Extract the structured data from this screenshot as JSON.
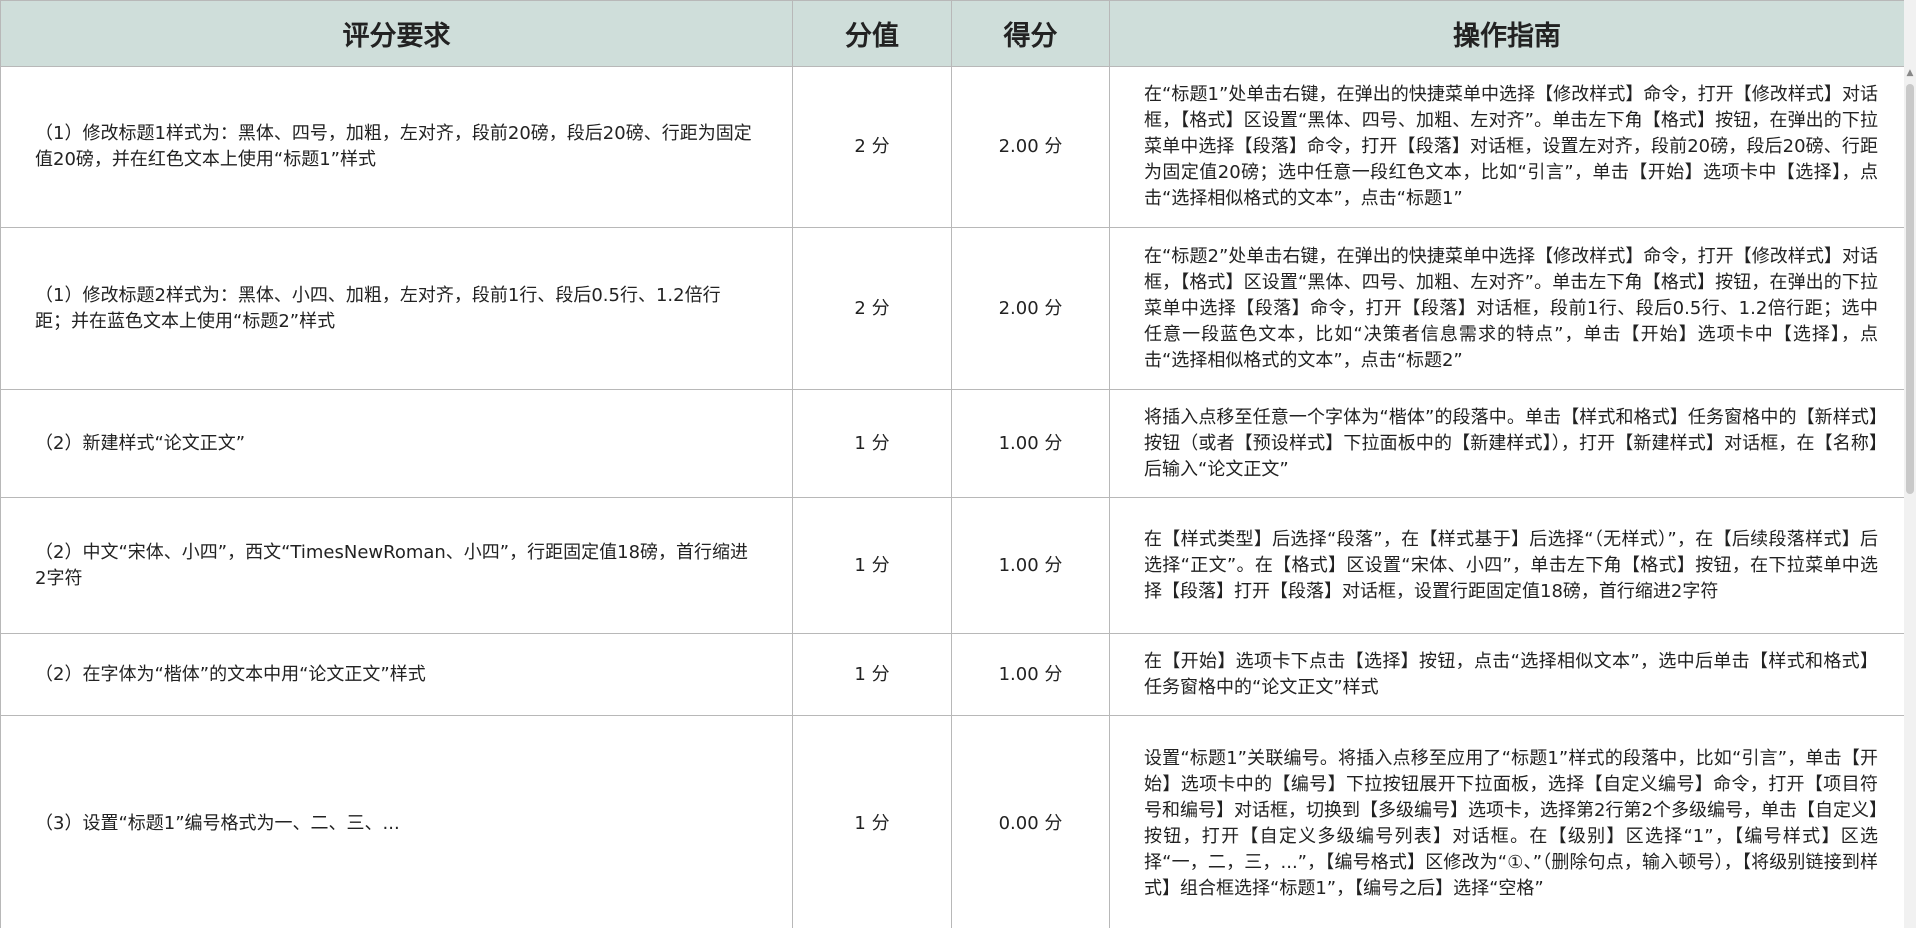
{
  "table": {
    "headers": {
      "requirement": "评分要求",
      "score": "分值",
      "obtained": "得分",
      "guide": "操作指南"
    },
    "rows": [
      {
        "requirement": "（1）修改标题1样式为：黑体、四号，加粗，左对齐，段前20磅，段后20磅、行距为固定值20磅，并在红色文本上使用“标题1”样式",
        "score": "2 分",
        "obtained": "2.00 分",
        "guide": "在“标题1”处单击右键，在弹出的快捷菜单中选择【修改样式】命令，打开【修改样式】对话框，【格式】区设置“黑体、四号、加粗、左对齐”。单击左下角【格式】按钮，在弹出的下拉菜单中选择【段落】命令，打开【段落】对话框，设置左对齐，段前20磅，段后20磅、行距为固定值20磅；选中任意一段红色文本，比如“引言”，单击【开始】选项卡中【选择】，点击“选择相似格式的文本”，点击“标题1”"
      },
      {
        "requirement": "（1）修改标题2样式为：黑体、小四、加粗，左对齐，段前1行、段后0.5行、1.2倍行距；并在蓝色文本上使用“标题2”样式",
        "score": "2 分",
        "obtained": "2.00 分",
        "guide": "在“标题2”处单击右键，在弹出的快捷菜单中选择【修改样式】命令，打开【修改样式】对话框，【格式】区设置“黑体、四号、加粗、左对齐”。单击左下角【格式】按钮，在弹出的下拉菜单中选择【段落】命令，打开【段落】对话框，段前1行、段后0.5行、1.2倍行距；选中任意一段蓝色文本，比如“决策者信息需求的特点”，单击【开始】选项卡中【选择】，点击“选择相似格式的文本”，点击“标题2”"
      },
      {
        "requirement": "（2）新建样式“论文正文”",
        "score": "1 分",
        "obtained": "1.00 分",
        "guide": "将插入点移至任意一个字体为“楷体”的段落中。单击【样式和格式】任务窗格中的【新样式】按钮（或者【预设样式】下拉面板中的【新建样式】），打开【新建样式】对话框，在【名称】后输入“论文正文”"
      },
      {
        "requirement": "（2）中文“宋体、小四”，西文“TimesNewRoman、小四”，行距固定值18磅，首行缩进2字符",
        "score": "1 分",
        "obtained": "1.00 分",
        "guide": "在【样式类型】后选择“段落”，在【样式基于】后选择“（无样式）”，在【后续段落样式】后选择“正文”。在【格式】区设置“宋体、小四”，单击左下角【格式】按钮，在下拉菜单中选择【段落】打开【段落】对话框，设置行距固定值18磅，首行缩进2字符"
      },
      {
        "requirement": "（2）在字体为“楷体”的文本中用“论文正文”样式",
        "score": "1 分",
        "obtained": "1.00 分",
        "guide": "在【开始】选项卡下点击【选择】按钮，点击“选择相似文本”，选中后单击【样式和格式】任务窗格中的“论文正文”样式"
      },
      {
        "requirement": "（3）设置“标题1”编号格式为一、二、三、...",
        "score": "1 分",
        "obtained": "0.00 分",
        "guide": "设置“标题1”关联编号。将插入点移至应用了“标题1”样式的段落中，比如“引言”，单击【开始】选项卡中的【编号】下拉按钮展开下拉面板，选择【自定义编号】命令，打开【项目符号和编号】对话框，切换到【多级编号】选项卡，选择第2行第2个多级编号，单击【自定义】按钮，打开【自定义多级编号列表】对话框。在【级别】区选择“1”，【编号样式】区选择“一，二，三，...”，【编号格式】区修改为“①、”（删除句点，输入顿号），【将级别链接到样式】组合框选择“标题1”，【编号之后】选择“空格”"
      }
    ]
  }
}
